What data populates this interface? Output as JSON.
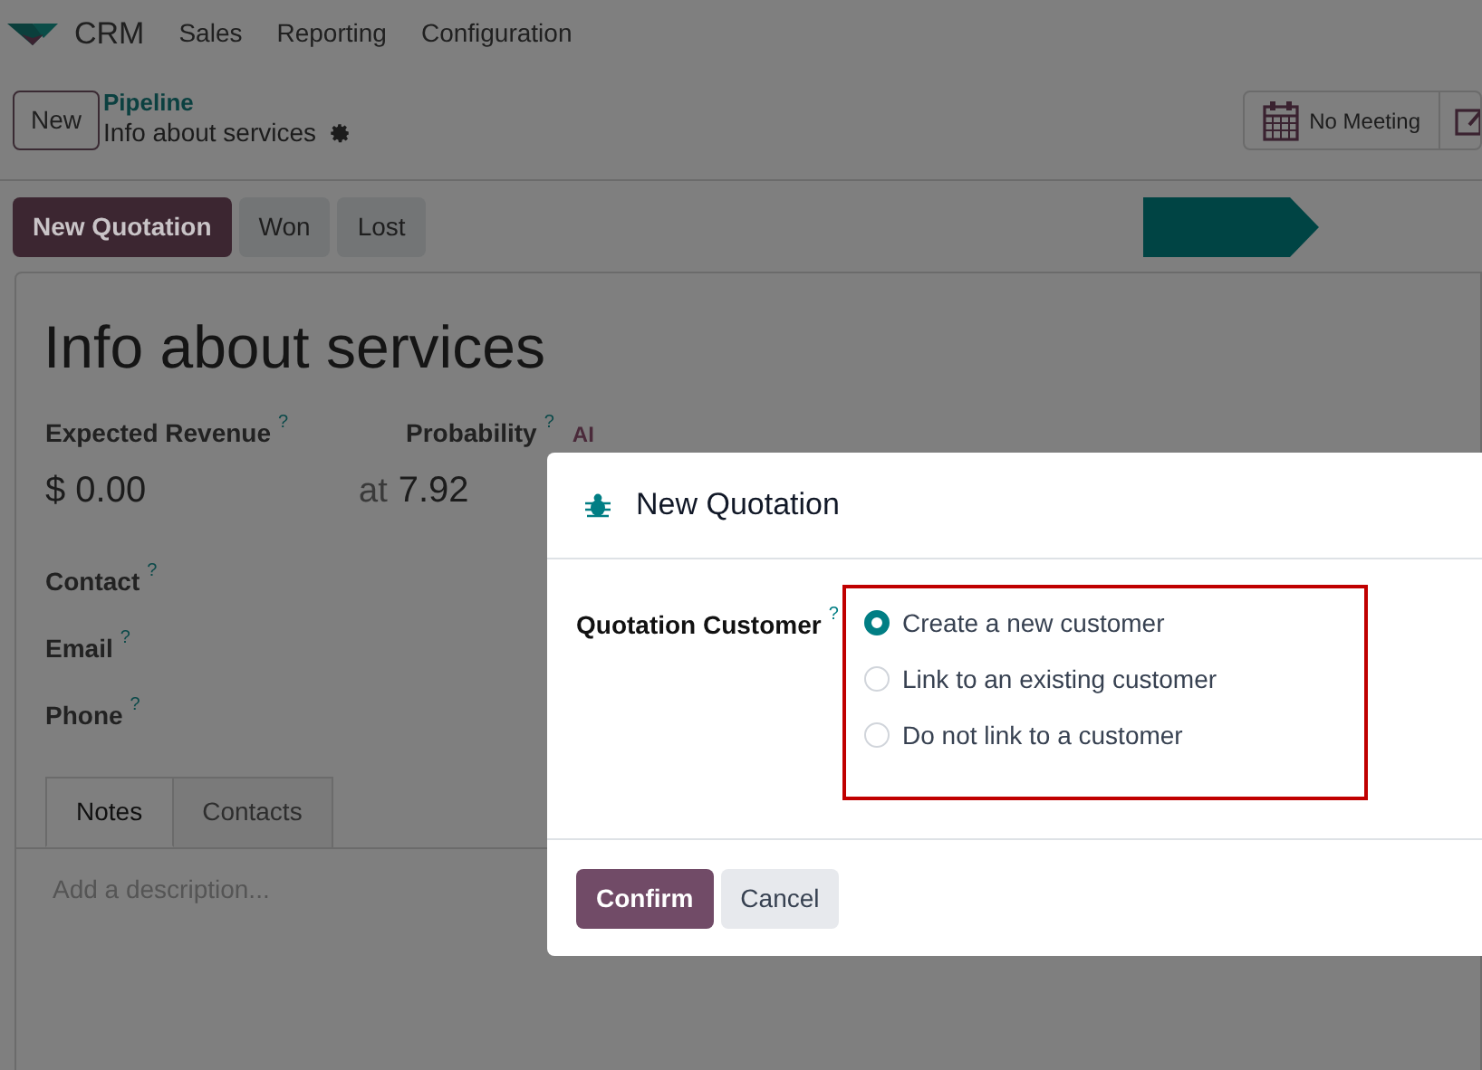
{
  "navbar": {
    "app": "CRM",
    "menus": [
      "Sales",
      "Reporting",
      "Configuration"
    ]
  },
  "control_panel": {
    "new_button": "New",
    "breadcrumb": "Pipeline",
    "record": "Info about services",
    "activity_button": "No Meeting"
  },
  "status_bar": {
    "buttons": [
      {
        "label": "New Quotation",
        "kind": "primary"
      },
      {
        "label": "Won",
        "kind": "secondary"
      },
      {
        "label": "Lost",
        "kind": "secondary"
      }
    ]
  },
  "form": {
    "title": "Info about services",
    "revenue": {
      "label": "Expected Revenue",
      "hint": "?",
      "value": "$ 0.00"
    },
    "probability": {
      "label": "Probability",
      "hint": "?",
      "badge": "AI",
      "prefix": "at",
      "value": "7.92"
    },
    "fields": [
      {
        "label": "Contact",
        "hint": "?"
      },
      {
        "label": "Email",
        "hint": "?"
      },
      {
        "label": "Phone",
        "hint": "?"
      }
    ],
    "tabs": [
      {
        "label": "Notes",
        "selected": true
      },
      {
        "label": "Contacts",
        "selected": false
      }
    ],
    "description": {
      "placeholder": "Add a description..."
    }
  },
  "dialog": {
    "title": "New Quotation",
    "field_label": "Quotation Customer",
    "hint": "?",
    "options": [
      {
        "label": "Create a new customer",
        "selected": true
      },
      {
        "label": "Link to an existing customer",
        "selected": false
      },
      {
        "label": "Do not link to a customer",
        "selected": false
      }
    ],
    "buttons": [
      {
        "label": "Confirm",
        "kind": "primary"
      },
      {
        "label": "Cancel",
        "kind": "secondary"
      }
    ]
  }
}
